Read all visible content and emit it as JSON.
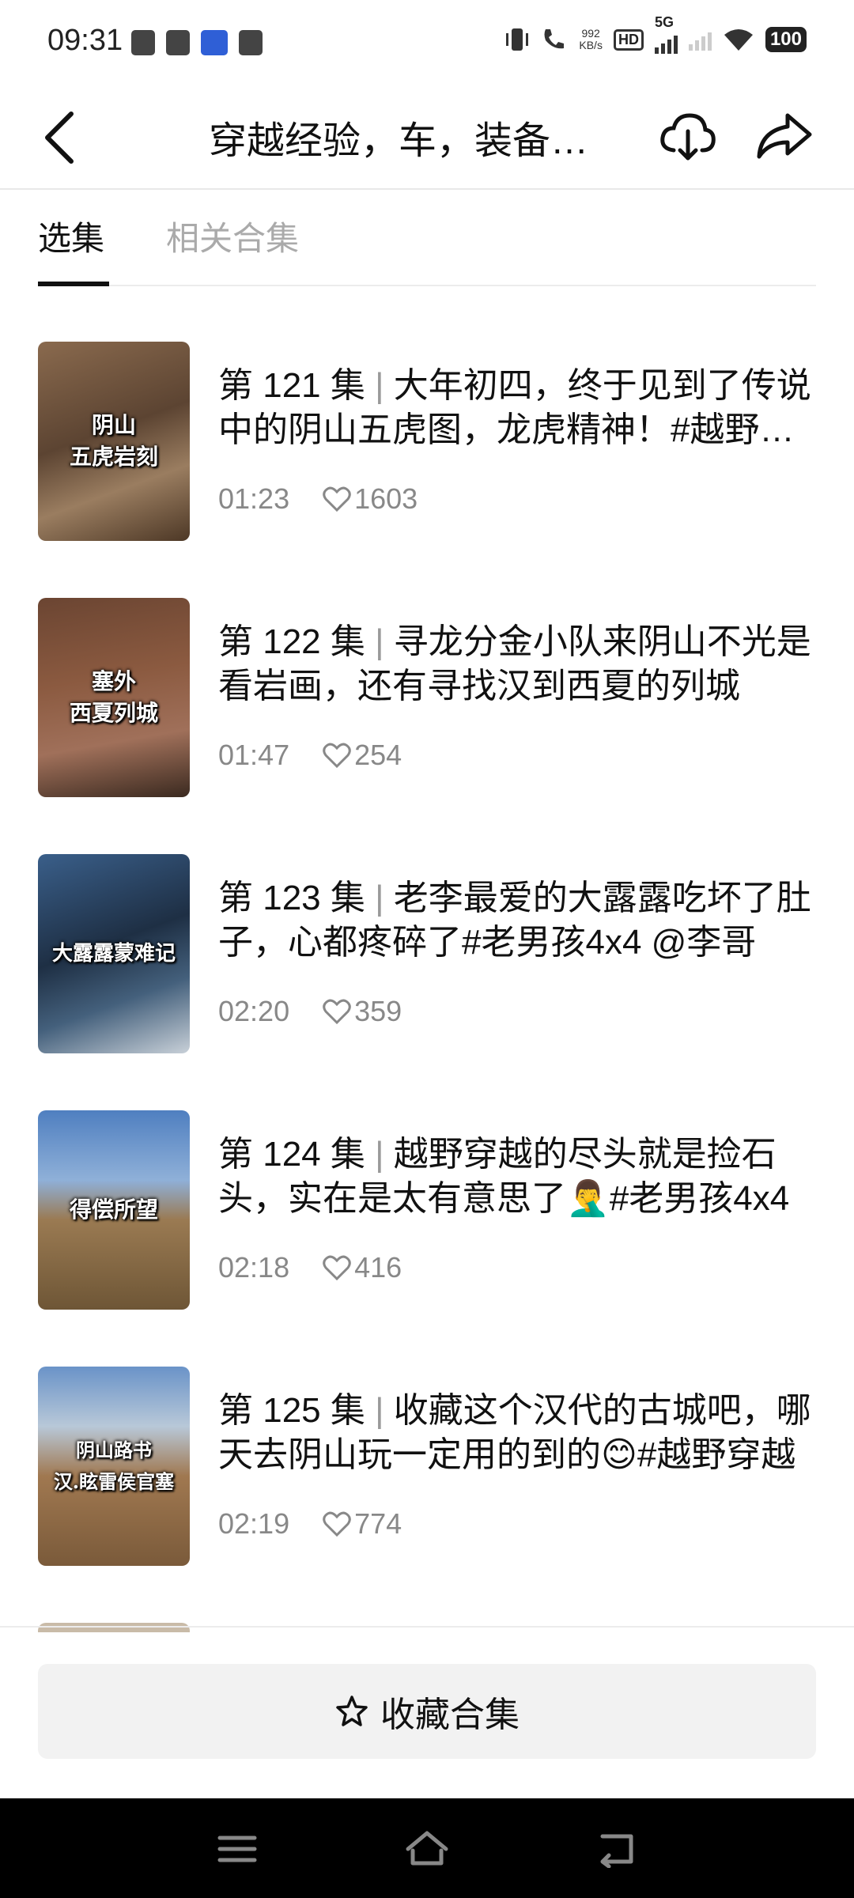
{
  "status_bar": {
    "time": "09:31",
    "net_speed_value": "992",
    "net_speed_unit": "KB/s",
    "hd": "HD",
    "network": "5G",
    "battery": "100"
  },
  "header": {
    "title": "穿越经验，车，装备…",
    "icons": [
      "back-icon",
      "download-icon",
      "share-icon"
    ]
  },
  "tabs": [
    {
      "label": "选集",
      "active": true
    },
    {
      "label": "相关合集",
      "active": false
    }
  ],
  "episodes": [
    {
      "thumb_text": "阴山\n五虎岩刻",
      "title_prefix": "第 121 集",
      "title": "大年初四，终于见到了传说中的阴山五虎图，龙虎精神！#越野穿越",
      "duration": "01:23",
      "likes": "1603"
    },
    {
      "thumb_text": "塞外\n西夏列城",
      "title_prefix": "第 122 集",
      "title": "寻龙分金小队来阴山不光是看岩画，还有寻找汉到西夏的列城",
      "duration": "01:47",
      "likes": "254"
    },
    {
      "thumb_text": "大露露蒙难记",
      "title_prefix": "第 123 集",
      "title": "老李最爱的大露露吃坏了肚子，心都疼碎了#老男孩4x4 @李哥",
      "duration": "02:20",
      "likes": "359"
    },
    {
      "thumb_text": "得偿所望",
      "title_prefix": "第 124 集",
      "title": "越野穿越的尽头就是捡石头，实在是太有意思了🤦‍♂️#老男孩4x4",
      "duration": "02:18",
      "likes": "416"
    },
    {
      "thumb_text": "阴山路书\n汉.眩雷侯官塞",
      "title_prefix": "第 125 集",
      "title": "收藏这个汉代的古城吧，哪天去阴山玩一定用的到的😊#越野穿越",
      "duration": "02:19",
      "likes": "774"
    }
  ],
  "collect_button": {
    "label": "收藏合集",
    "icon": "star-icon"
  },
  "nav_bar": {
    "icons": [
      "menu-icon",
      "home-icon",
      "back-nav-icon"
    ]
  }
}
